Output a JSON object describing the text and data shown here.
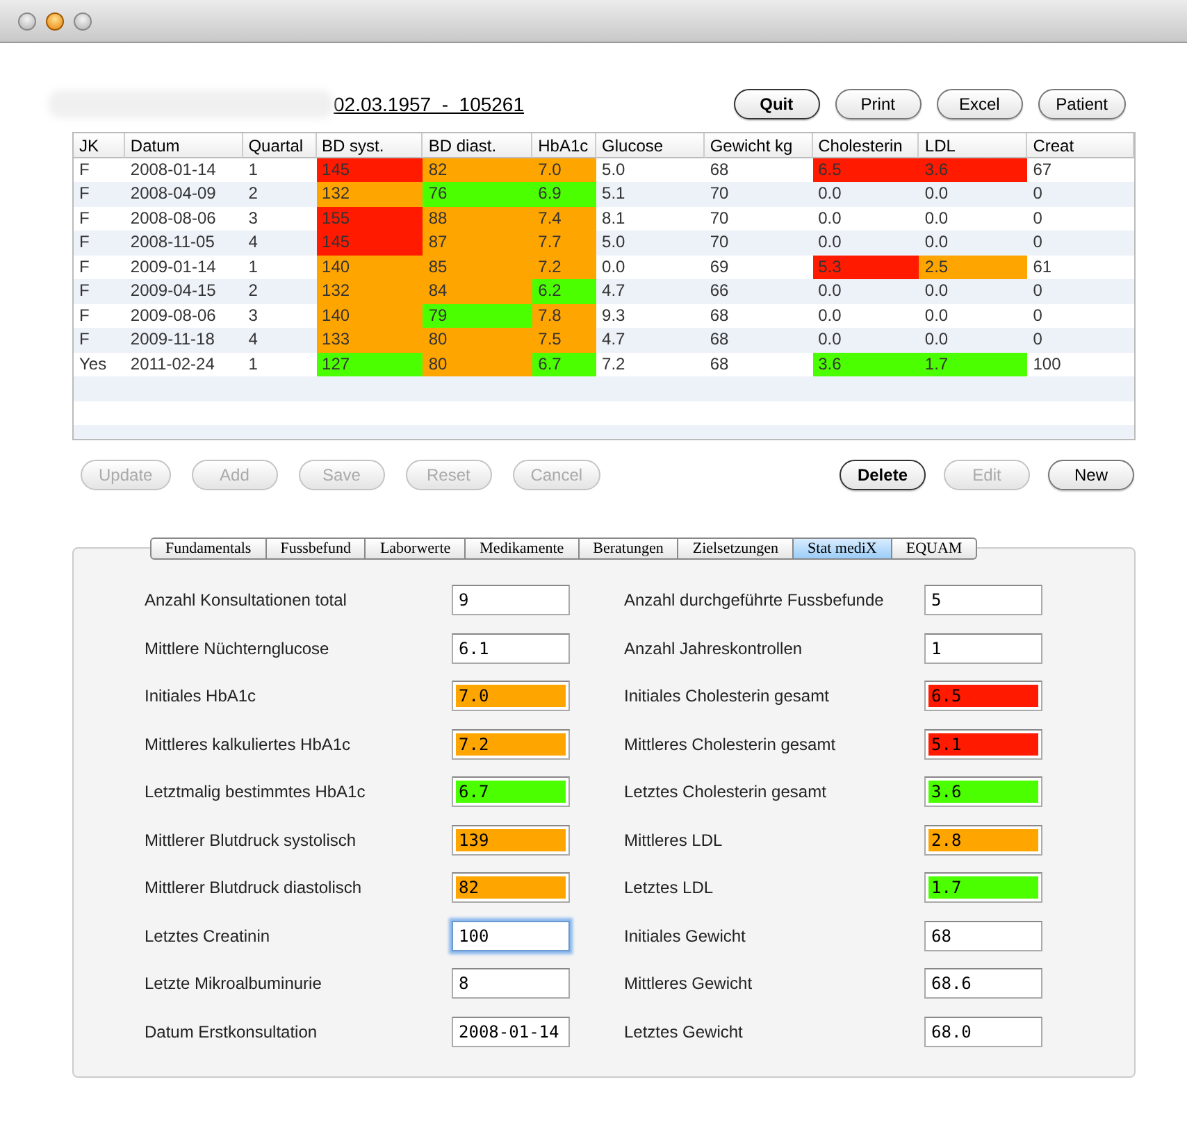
{
  "header": {
    "patient_info": "02.03.1957  -  105261"
  },
  "top_buttons": [
    {
      "label": "Quit",
      "default": true,
      "disabled": false
    },
    {
      "label": "Print",
      "default": false,
      "disabled": false
    },
    {
      "label": "Excel",
      "default": false,
      "disabled": false
    },
    {
      "label": "Patient",
      "default": false,
      "disabled": false
    }
  ],
  "table": {
    "columns": [
      "JK",
      "Datum",
      "Quartal",
      "BD syst.",
      "BD diast.",
      "HbA1c",
      "Glucose",
      "Gewicht kg",
      "Cholesterin",
      "LDL",
      "Creat"
    ],
    "rows": [
      [
        {
          "text": "F"
        },
        {
          "text": "2008-01-14"
        },
        {
          "text": "1"
        },
        {
          "text": "145",
          "color": "#ff1a00"
        },
        {
          "text": "82",
          "color": "#ffa500"
        },
        {
          "text": "7.0",
          "color": "#ffa500"
        },
        {
          "text": "5.0"
        },
        {
          "text": "68"
        },
        {
          "text": "6.5",
          "color": "#ff1a00"
        },
        {
          "text": "3.6",
          "color": "#ff1a00"
        },
        {
          "text": "67"
        }
      ],
      [
        {
          "text": "F"
        },
        {
          "text": "2008-04-09"
        },
        {
          "text": "2"
        },
        {
          "text": "132",
          "color": "#ffa500"
        },
        {
          "text": "76",
          "color": "#4cff00"
        },
        {
          "text": "6.9",
          "color": "#4cff00"
        },
        {
          "text": "5.1"
        },
        {
          "text": "70"
        },
        {
          "text": "0.0"
        },
        {
          "text": "0.0"
        },
        {
          "text": "0"
        }
      ],
      [
        {
          "text": "F"
        },
        {
          "text": "2008-08-06"
        },
        {
          "text": "3"
        },
        {
          "text": "155",
          "color": "#ff1a00"
        },
        {
          "text": "88",
          "color": "#ffa500"
        },
        {
          "text": "7.4",
          "color": "#ffa500"
        },
        {
          "text": "8.1"
        },
        {
          "text": "70"
        },
        {
          "text": "0.0"
        },
        {
          "text": "0.0"
        },
        {
          "text": "0"
        }
      ],
      [
        {
          "text": "F"
        },
        {
          "text": "2008-11-05"
        },
        {
          "text": "4"
        },
        {
          "text": "145",
          "color": "#ff1a00"
        },
        {
          "text": "87",
          "color": "#ffa500"
        },
        {
          "text": "7.7",
          "color": "#ffa500"
        },
        {
          "text": "5.0"
        },
        {
          "text": "70"
        },
        {
          "text": "0.0"
        },
        {
          "text": "0.0"
        },
        {
          "text": "0"
        }
      ],
      [
        {
          "text": "F"
        },
        {
          "text": "2009-01-14"
        },
        {
          "text": "1"
        },
        {
          "text": "140",
          "color": "#ffa500"
        },
        {
          "text": "85",
          "color": "#ffa500"
        },
        {
          "text": "7.2",
          "color": "#ffa500"
        },
        {
          "text": "0.0"
        },
        {
          "text": "69"
        },
        {
          "text": "5.3",
          "color": "#ff1a00"
        },
        {
          "text": "2.5",
          "color": "#ffa500"
        },
        {
          "text": "61"
        }
      ],
      [
        {
          "text": "F"
        },
        {
          "text": "2009-04-15"
        },
        {
          "text": "2"
        },
        {
          "text": "132",
          "color": "#ffa500"
        },
        {
          "text": "84",
          "color": "#ffa500"
        },
        {
          "text": "6.2",
          "color": "#4cff00"
        },
        {
          "text": "4.7"
        },
        {
          "text": "66"
        },
        {
          "text": "0.0"
        },
        {
          "text": "0.0"
        },
        {
          "text": "0"
        }
      ],
      [
        {
          "text": "F"
        },
        {
          "text": "2009-08-06"
        },
        {
          "text": "3"
        },
        {
          "text": "140",
          "color": "#ffa500"
        },
        {
          "text": "79",
          "color": "#4cff00"
        },
        {
          "text": "7.8",
          "color": "#ffa500"
        },
        {
          "text": "9.3"
        },
        {
          "text": "68"
        },
        {
          "text": "0.0"
        },
        {
          "text": "0.0"
        },
        {
          "text": "0"
        }
      ],
      [
        {
          "text": "F"
        },
        {
          "text": "2009-11-18"
        },
        {
          "text": "4"
        },
        {
          "text": "133",
          "color": "#ffa500"
        },
        {
          "text": "80",
          "color": "#ffa500"
        },
        {
          "text": "7.5",
          "color": "#ffa500"
        },
        {
          "text": "4.7"
        },
        {
          "text": "68"
        },
        {
          "text": "0.0"
        },
        {
          "text": "0.0"
        },
        {
          "text": "0"
        }
      ],
      [
        {
          "text": "Yes"
        },
        {
          "text": "2011-02-24"
        },
        {
          "text": "1"
        },
        {
          "text": "127",
          "color": "#4cff00"
        },
        {
          "text": "80",
          "color": "#ffa500"
        },
        {
          "text": "6.7",
          "color": "#4cff00"
        },
        {
          "text": "7.2"
        },
        {
          "text": "68"
        },
        {
          "text": "3.6",
          "color": "#4cff00"
        },
        {
          "text": "1.7",
          "color": "#4cff00"
        },
        {
          "text": "100"
        }
      ]
    ]
  },
  "edit_buttons": [
    {
      "label": "Update",
      "default": false,
      "disabled": true
    },
    {
      "label": "Add",
      "default": false,
      "disabled": true
    },
    {
      "label": "Save",
      "default": false,
      "disabled": true
    },
    {
      "label": "Reset",
      "default": false,
      "disabled": true
    },
    {
      "label": "Cancel",
      "default": false,
      "disabled": true
    }
  ],
  "record_buttons": [
    {
      "label": "Delete",
      "default": true,
      "disabled": false
    },
    {
      "label": "Edit",
      "default": false,
      "disabled": true
    },
    {
      "label": "New",
      "default": false,
      "disabled": false
    }
  ],
  "tabs": [
    {
      "label": "Fundamentals",
      "selected": false
    },
    {
      "label": "Fussbefund",
      "selected": false
    },
    {
      "label": "Laborwerte",
      "selected": false
    },
    {
      "label": "Medikamente",
      "selected": false
    },
    {
      "label": "Beratungen",
      "selected": false
    },
    {
      "label": "Zielsetzungen",
      "selected": false
    },
    {
      "label": "Stat mediX",
      "selected": true
    },
    {
      "label": "EQUAM",
      "selected": false
    }
  ],
  "stats_left": [
    {
      "label": "Anzahl Konsultationen total",
      "value": "9",
      "focused": false
    },
    {
      "label": "Mittlere Nüchternglucose",
      "value": "6.1",
      "focused": false
    },
    {
      "label": "Initiales HbA1c",
      "value": "7.0",
      "color": "#ffa500",
      "focused": false
    },
    {
      "label": "Mittleres kalkuliertes HbA1c",
      "value": "7.2",
      "color": "#ffa500",
      "focused": false
    },
    {
      "label": "Letztmalig bestimmtes HbA1c",
      "value": "6.7",
      "color": "#4cff00",
      "focused": false
    },
    {
      "label": "Mittlerer Blutdruck systolisch",
      "value": "139",
      "color": "#ffa500",
      "focused": false
    },
    {
      "label": "Mittlerer Blutdruck diastolisch",
      "value": "82",
      "color": "#ffa500",
      "focused": false
    },
    {
      "label": "Letztes Creatinin",
      "value": "100",
      "focused": true
    },
    {
      "label": "Letzte Mikroalbuminurie",
      "value": "8",
      "focused": false
    },
    {
      "label": "Datum Erstkonsultation",
      "value": "2008-01-14",
      "focused": false
    }
  ],
  "stats_right": [
    {
      "label": "Anzahl durchgeführte Fussbefunde",
      "value": "5",
      "focused": false
    },
    {
      "label": "Anzahl Jahreskontrollen",
      "value": "1",
      "focused": false
    },
    {
      "label": "Initiales Cholesterin gesamt",
      "value": "6.5",
      "color": "#ff1a00",
      "focused": false
    },
    {
      "label": "Mittleres Cholesterin gesamt",
      "value": "5.1",
      "color": "#ff1a00",
      "focused": false
    },
    {
      "label": "Letztes Cholesterin gesamt",
      "value": "3.6",
      "color": "#4cff00",
      "focused": false
    },
    {
      "label": "Mittleres LDL",
      "value": "2.8",
      "color": "#ffa500",
      "focused": false
    },
    {
      "label": "Letztes LDL",
      "value": "1.7",
      "color": "#4cff00",
      "focused": false
    },
    {
      "label": "Initiales Gewicht",
      "value": "68",
      "focused": false
    },
    {
      "label": "Mittleres Gewicht",
      "value": "68.6",
      "focused": false
    },
    {
      "label": "Letztes Gewicht",
      "value": "68.0",
      "focused": false
    }
  ]
}
